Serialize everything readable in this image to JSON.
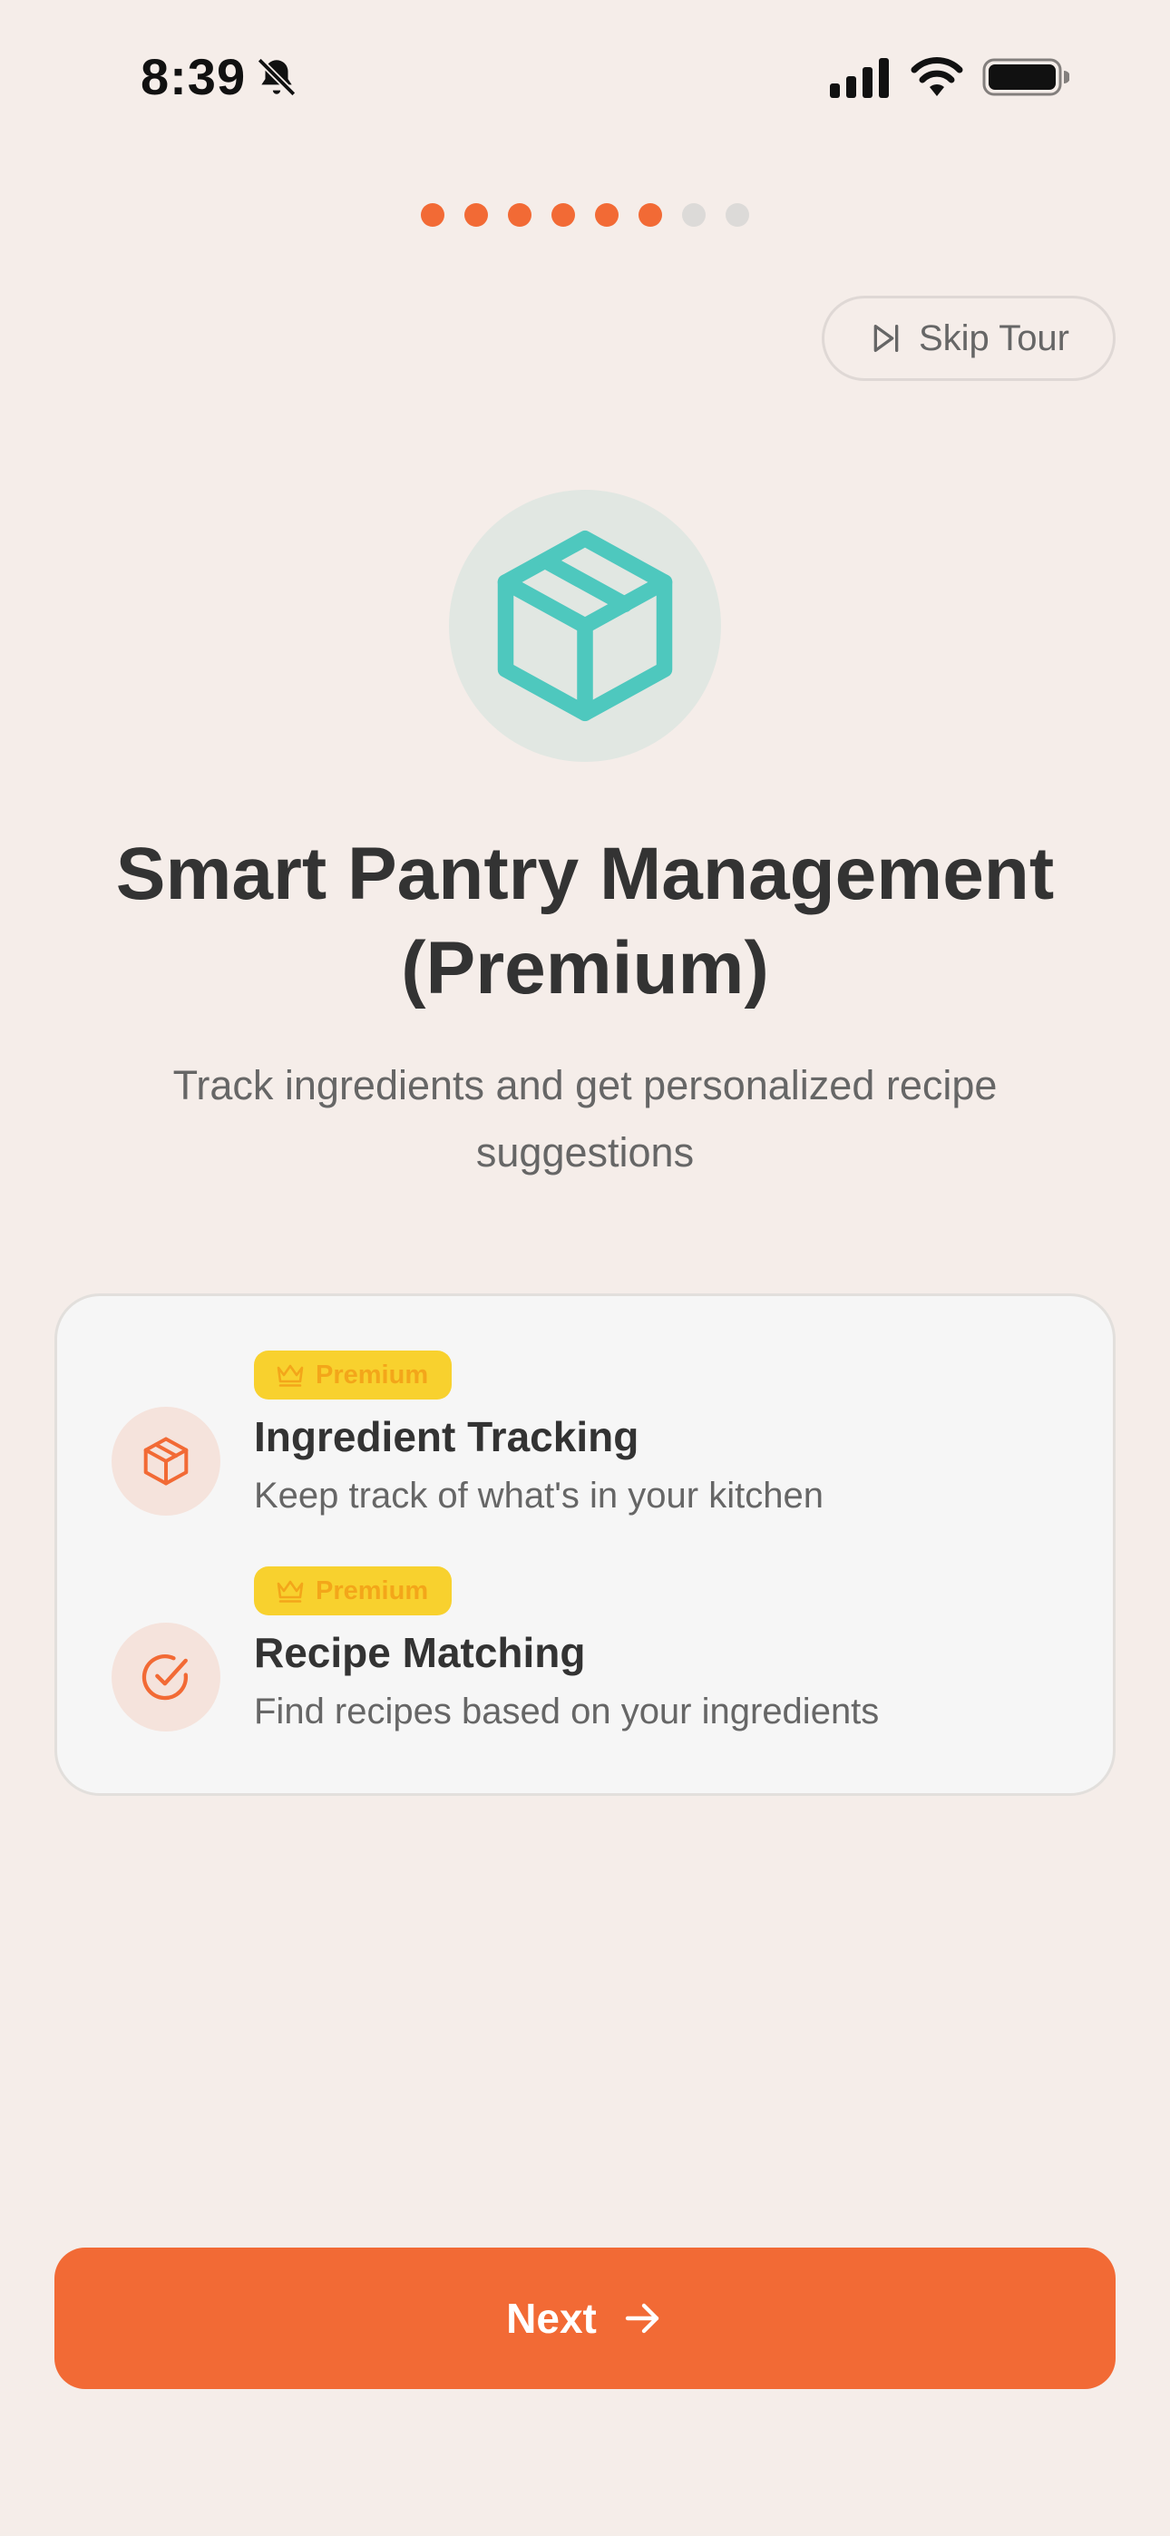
{
  "status_bar": {
    "time": "8:39",
    "icons": [
      "bell-slash-icon",
      "cellular-signal-icon",
      "wifi-icon",
      "battery-icon"
    ]
  },
  "onboarding": {
    "total_steps": 8,
    "current_step": 6
  },
  "skip": {
    "label": "Skip Tour",
    "icon": "skip-forward-icon"
  },
  "hero": {
    "icon": "box-icon"
  },
  "title": "Smart Pantry Management (Premium)",
  "subtitle": "Track ingredients and get personalized recipe suggestions",
  "features": [
    {
      "badge": "Premium",
      "title": "Ingredient Tracking",
      "description": "Keep track of what's in your kitchen",
      "icon": "box-icon"
    },
    {
      "badge": "Premium",
      "title": "Recipe Matching",
      "description": "Find recipes based on your ingredients",
      "icon": "check-circle-icon"
    }
  ],
  "next_button": {
    "label": "Next",
    "icon": "arrow-right-icon"
  },
  "colors": {
    "background": "#F5EDE9",
    "accent": "#F26A35",
    "hero_icon": "#4EC8BE",
    "premium_badge_bg": "#F8D12E",
    "premium_badge_text": "#F3A61A",
    "inactive_dot": "#DCDAD8"
  }
}
